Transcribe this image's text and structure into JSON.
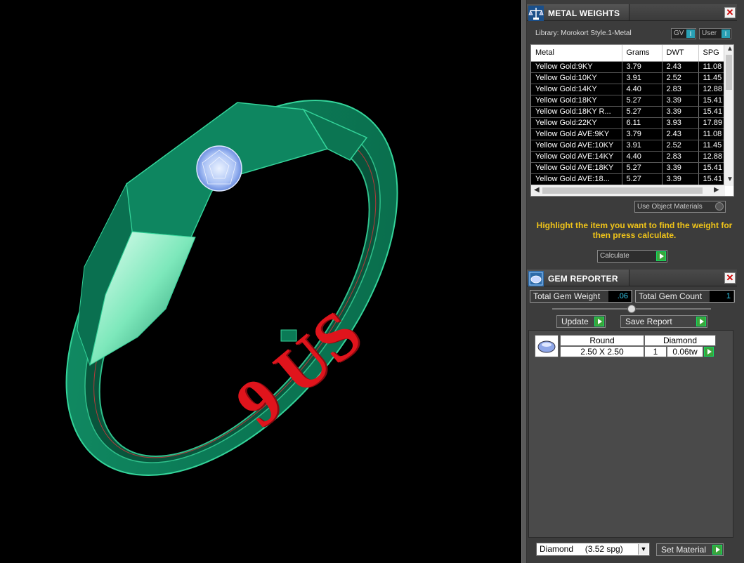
{
  "viewport": {
    "ring_text": "9 US"
  },
  "metal_weights": {
    "title": "METAL WEIGHTS",
    "library_label": "Library: Morokort Style.1-Metal",
    "toggle_gv": "GV",
    "toggle_user": "User",
    "columns": [
      "Metal",
      "Grams",
      "DWT",
      "SPG"
    ],
    "rows": [
      [
        "Yellow Gold:9KY",
        "3.79",
        "2.43",
        "11.08"
      ],
      [
        "Yellow Gold:10KY",
        "3.91",
        "2.52",
        "11.45"
      ],
      [
        "Yellow Gold:14KY",
        "4.40",
        "2.83",
        "12.88"
      ],
      [
        "Yellow Gold:18KY",
        "5.27",
        "3.39",
        "15.41"
      ],
      [
        "Yellow Gold:18KY R...",
        "5.27",
        "3.39",
        "15.41"
      ],
      [
        "Yellow Gold:22KY",
        "6.11",
        "3.93",
        "17.89"
      ],
      [
        "Yellow Gold AVE:9KY",
        "3.79",
        "2.43",
        "11.08"
      ],
      [
        "Yellow Gold AVE:10KY",
        "3.91",
        "2.52",
        "11.45"
      ],
      [
        "Yellow Gold AVE:14KY",
        "4.40",
        "2.83",
        "12.88"
      ],
      [
        "Yellow Gold AVE:18KY",
        "5.27",
        "3.39",
        "15.41"
      ],
      [
        "Yellow Gold AVE:18...",
        "5.27",
        "3.39",
        "15.41"
      ]
    ],
    "use_object_materials": "Use Object Materials",
    "hint": "Highlight the item you want to find the weight for then press calculate.",
    "calculate_label": "Calculate"
  },
  "gem_reporter": {
    "title": "GEM REPORTER",
    "total_weight_label": "Total Gem Weight",
    "total_weight_value": ".06",
    "total_count_label": "Total Gem Count",
    "total_count_value": "1",
    "update_label": "Update",
    "save_report_label": "Save Report",
    "gems": [
      {
        "shape": "Round",
        "material": "Diamond",
        "size": "2.50 X 2.50",
        "count": "1",
        "weight": "0.06tw"
      }
    ],
    "material_select": "Diamond     (3.52 spg)",
    "set_material_label": "Set Material"
  },
  "colors": {
    "ring_green": "#0f8a63",
    "label_red": "#e0141c",
    "hint_yellow": "#f0c419",
    "accent_teal": "#29a0b5",
    "go_green": "#3aa63a"
  }
}
